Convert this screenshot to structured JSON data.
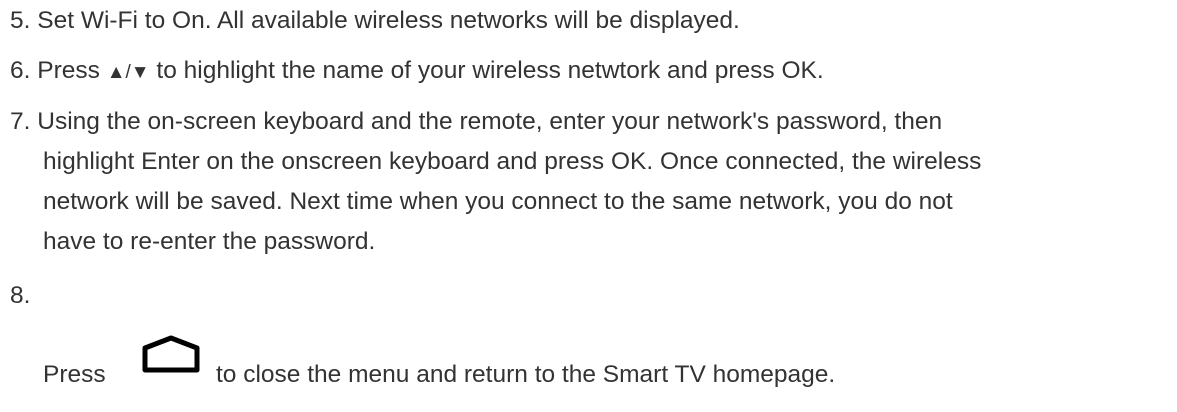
{
  "steps": [
    {
      "number": "5.",
      "lines": [
        "Set Wi-Fi to On. All available wireless networks will be displayed."
      ]
    },
    {
      "number": "6.",
      "before_arrows": "Press ",
      "arrows": "▲/▼",
      "after_arrows": " to highlight the name of your wireless netwtork and press OK."
    },
    {
      "number": "7.",
      "lines": [
        "Using the on-screen keyboard and the remote, enter your network's password, then",
        "highlight Enter on the onscreen keyboard and press OK. Once connected, the wireless",
        "network will be saved. Next time when you connect to the same network, you do not",
        "have to re-enter the password."
      ]
    },
    {
      "number": "8.",
      "press": "Press",
      "icon": "home-icon",
      "after_icon": "to close the menu and return to the Smart TV homepage."
    }
  ]
}
